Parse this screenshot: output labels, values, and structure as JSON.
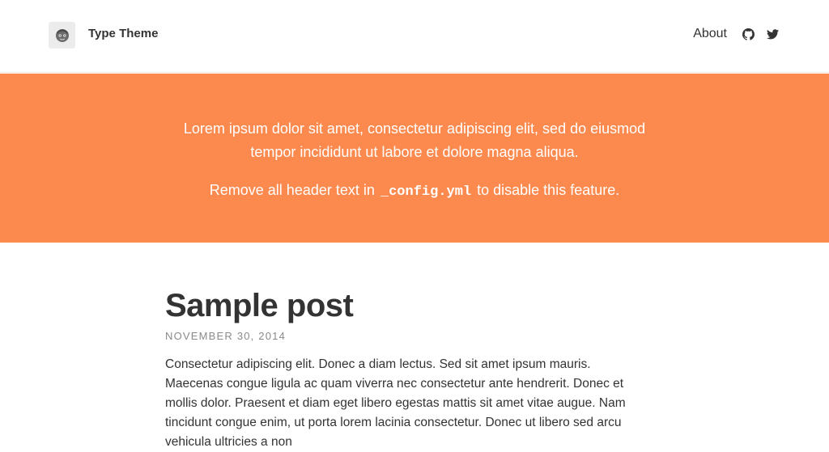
{
  "header": {
    "site_title": "Type Theme",
    "avatar_icon": "avatar-face-icon",
    "nav": {
      "about_label": "About",
      "github_icon": "github-icon",
      "twitter_icon": "twitter-icon"
    }
  },
  "banner": {
    "background_color": "#fc894d",
    "text": "Lorem ipsum dolor sit amet, consectetur adipiscing elit, sed do eiusmod tempor incididunt ut labore et dolore magna aliqua.",
    "config_prefix": "Remove all header text in",
    "config_file": "_config.yml",
    "config_suffix": "to disable this feature."
  },
  "post": {
    "title": "Sample post",
    "date": "NOVEMBER 30, 2014",
    "excerpt": "Consectetur adipiscing elit. Donec a diam lectus. Sed sit amet ipsum mauris. Maecenas congue ligula ac quam viverra nec consectetur ante hendrerit. Donec et mollis dolor. Praesent et diam eget libero egestas mattis sit amet vitae augue. Nam tincidunt congue enim, ut porta lorem lacinia consectetur. Donec ut libero sed arcu vehicula ultricies a non"
  }
}
